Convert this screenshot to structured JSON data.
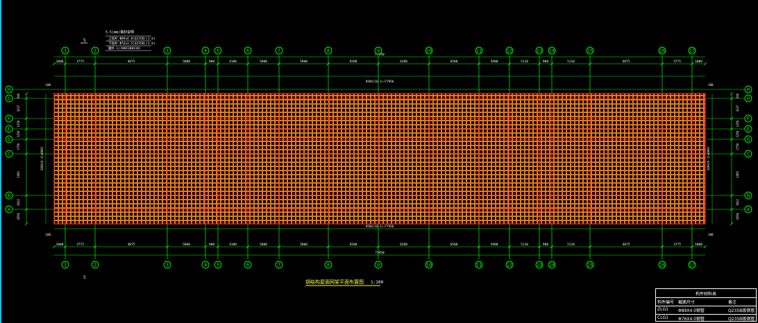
{
  "colors": {
    "background": "#000000",
    "grid": "#00ff00",
    "axis_bubble": "#00ff00",
    "hatch": "#ff8a1a",
    "beam": "#ff2a2a",
    "text": "#ffffff",
    "accent": "#00ffff"
  },
  "grid_x": [
    "1",
    "2",
    "3",
    "4",
    "5",
    "6",
    "7",
    "8",
    "9",
    "10",
    "11",
    "12",
    "13",
    "14",
    "15",
    "16",
    "17"
  ],
  "grid_y": [
    "H",
    "G",
    "F",
    "E",
    "D",
    "C",
    "B",
    "A"
  ],
  "dims_top": [
    "1000",
    "3775",
    "4875",
    "5800",
    "900",
    "4100",
    "5800",
    "5800",
    "6500",
    "6200",
    "6500",
    "5900",
    "5110",
    "900",
    "5110",
    "4875",
    "3775",
    "1000"
  ],
  "dim_total": "77950",
  "dim_span_label": "850X(16-1)+77950",
  "dims_side": [
    "540",
    "3237",
    "1250",
    "1250",
    "1750",
    "1450",
    "3812",
    "1854",
    "1000"
  ],
  "side_total": "2000(6-1)+8000",
  "small_dims": {
    "left": "100",
    "right": "100"
  },
  "section_mark": "5",
  "notes": {
    "title": "5.5(mm)钢材说明",
    "lines": [
      "上弦杆  Φ89x4.0(Q235B)(1.6)",
      "下弦杆  Φ76x3.5(Q235B)(1.6)",
      "腹杆  L(100X100X10)"
    ]
  },
  "drawing_title": "钢结构屋面网架平面布置图",
  "drawing_scale": "1:100",
  "legend": {
    "title": "构件材料表",
    "headers": [
      "构件编号",
      "截面尺寸",
      "备注"
    ],
    "rows": [
      [
        "ZLG1",
        "Φ89X4.0钢管",
        "Q235B级钢管"
      ],
      [
        "CLG1",
        "Φ76X4.0钢管",
        "Q235B级钢管"
      ]
    ]
  }
}
